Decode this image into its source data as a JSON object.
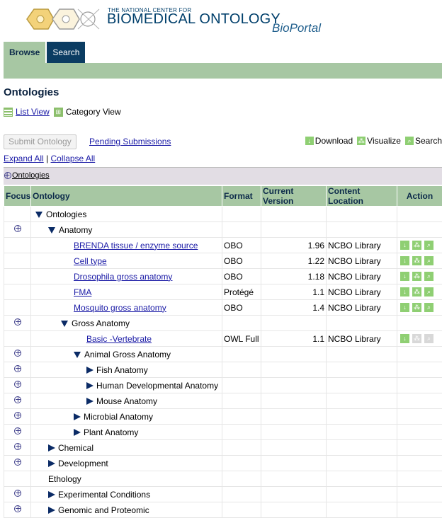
{
  "header": {
    "brand_small": "THE NATIONAL CENTER FOR",
    "brand_big": "BIOMEDICAL ONTOLOGY",
    "brand_bp": "BioPortal",
    "tabs": [
      "Browse",
      "Search"
    ]
  },
  "page_title": "Ontologies",
  "views": {
    "list": "List View",
    "category": "Category View"
  },
  "toolbar": {
    "submit": "Submit Ontology",
    "pending": "Pending Submissions",
    "download": "Download",
    "visualize": "Visualize",
    "search": "Search"
  },
  "tree_controls": {
    "expand": "Expand All",
    "collapse": "Collapse All"
  },
  "crumb": "Ontologies",
  "table": {
    "headers": [
      "Focus",
      "Ontology",
      "Format",
      "Current Version",
      "Content Location",
      "Action"
    ],
    "rows": [
      {
        "indent": 0,
        "expander": "down",
        "focus": false,
        "label": "Ontologies",
        "link": false,
        "format": "",
        "version": "",
        "location": "",
        "actions": ""
      },
      {
        "indent": 1,
        "expander": "down",
        "focus": true,
        "label": "Anatomy",
        "link": false,
        "format": "",
        "version": "",
        "location": "",
        "actions": ""
      },
      {
        "indent": 3,
        "expander": "",
        "focus": false,
        "label": "BRENDA tissue / enzyme source",
        "link": true,
        "format": "OBO",
        "version": "1.96",
        "location": "NCBO Library",
        "actions": "active"
      },
      {
        "indent": 3,
        "expander": "",
        "focus": false,
        "label": "Cell type",
        "link": true,
        "format": "OBO",
        "version": "1.22",
        "location": "NCBO Library",
        "actions": "active"
      },
      {
        "indent": 3,
        "expander": "",
        "focus": false,
        "label": "Drosophila gross anatomy",
        "link": true,
        "format": "OBO",
        "version": "1.18",
        "location": "NCBO Library",
        "actions": "active"
      },
      {
        "indent": 3,
        "expander": "",
        "focus": false,
        "label": "FMA",
        "link": true,
        "format": "Protégé",
        "version": "1.1",
        "location": "NCBO Library",
        "actions": "active"
      },
      {
        "indent": 3,
        "expander": "",
        "focus": false,
        "label": "Mosquito gross anatomy",
        "link": true,
        "format": "OBO",
        "version": "1.4",
        "location": "NCBO Library",
        "actions": "active"
      },
      {
        "indent": 2,
        "expander": "down",
        "focus": true,
        "label": "Gross Anatomy",
        "link": false,
        "format": "",
        "version": "",
        "location": "",
        "actions": ""
      },
      {
        "indent": 4,
        "expander": "",
        "focus": false,
        "label": "Basic -Vertebrate",
        "link": true,
        "format": "OWL Full",
        "version": "1.1",
        "location": "NCBO Library",
        "actions": "partial"
      },
      {
        "indent": 3,
        "expander": "down",
        "focus": true,
        "label": "Animal Gross Anatomy",
        "link": false,
        "format": "",
        "version": "",
        "location": "",
        "actions": ""
      },
      {
        "indent": 4,
        "expander": "right",
        "focus": true,
        "label": "Fish Anatomy",
        "link": false,
        "format": "",
        "version": "",
        "location": "",
        "actions": ""
      },
      {
        "indent": 4,
        "expander": "right",
        "focus": true,
        "label": "Human Developmental Anatomy",
        "link": false,
        "format": "",
        "version": "",
        "location": "",
        "actions": ""
      },
      {
        "indent": 4,
        "expander": "right",
        "focus": true,
        "label": "Mouse Anatomy",
        "link": false,
        "format": "",
        "version": "",
        "location": "",
        "actions": ""
      },
      {
        "indent": 3,
        "expander": "right",
        "focus": true,
        "label": "Microbial Anatomy",
        "link": false,
        "format": "",
        "version": "",
        "location": "",
        "actions": ""
      },
      {
        "indent": 3,
        "expander": "right",
        "focus": true,
        "label": "Plant Anatomy",
        "link": false,
        "format": "",
        "version": "",
        "location": "",
        "actions": ""
      },
      {
        "indent": 1,
        "expander": "right",
        "focus": true,
        "label": "Chemical",
        "link": false,
        "format": "",
        "version": "",
        "location": "",
        "actions": ""
      },
      {
        "indent": 1,
        "expander": "right",
        "focus": true,
        "label": "Development",
        "link": false,
        "format": "",
        "version": "",
        "location": "",
        "actions": ""
      },
      {
        "indent": 1,
        "expander": "",
        "focus": false,
        "label": "Ethology",
        "link": false,
        "format": "",
        "version": "",
        "location": "",
        "actions": ""
      },
      {
        "indent": 1,
        "expander": "right",
        "focus": true,
        "label": "Experimental Conditions",
        "link": false,
        "format": "",
        "version": "",
        "location": "",
        "actions": ""
      },
      {
        "indent": 1,
        "expander": "right",
        "focus": true,
        "label": "Genomic and Proteomic",
        "link": false,
        "format": "",
        "version": "",
        "location": "",
        "actions": ""
      }
    ]
  },
  "colors": {
    "accent_green": "#a7c7a3",
    "dark_blue": "#0b3c62",
    "icon_green": "#8fcf73"
  }
}
